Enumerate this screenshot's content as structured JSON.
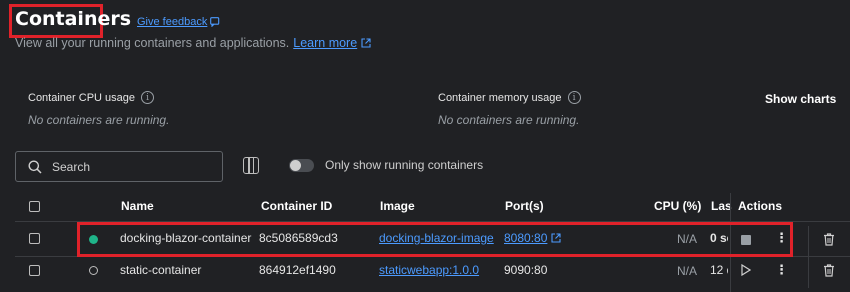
{
  "header": {
    "title": "Containers",
    "feedback_label": "Give feedback",
    "subtitle": "View all your running containers and applications.",
    "learn_more": "Learn more"
  },
  "stats": {
    "cpu_label": "Container CPU usage",
    "cpu_empty": "No containers are running.",
    "memory_label": "Container memory usage",
    "memory_empty": "No containers are running.",
    "show_charts": "Show charts"
  },
  "toolbar": {
    "search_placeholder": "Search",
    "toggle_label": "Only show running containers",
    "toggle_on": false
  },
  "table": {
    "columns": {
      "name": "Name",
      "container_id": "Container ID",
      "image": "Image",
      "ports": "Port(s)",
      "cpu": "CPU (%)",
      "last": "Las",
      "actions": "Actions"
    },
    "rows": [
      {
        "status": "running",
        "name": "docking-blazor-container",
        "container_id": "8c5086589cd3",
        "image": "docking-blazor-image",
        "port": "8080:80",
        "cpu": "N/A",
        "last": "0 se"
      },
      {
        "status": "stopped",
        "name": "static-container",
        "container_id": "864912ef1490",
        "image": "staticwebapp:1.0.0",
        "port": "9090:80",
        "cpu": "N/A",
        "last": "12 d"
      }
    ]
  },
  "colors": {
    "background": "#202124",
    "link": "#4c9bff",
    "running": "#1fb489",
    "highlight": "#e0222a"
  }
}
